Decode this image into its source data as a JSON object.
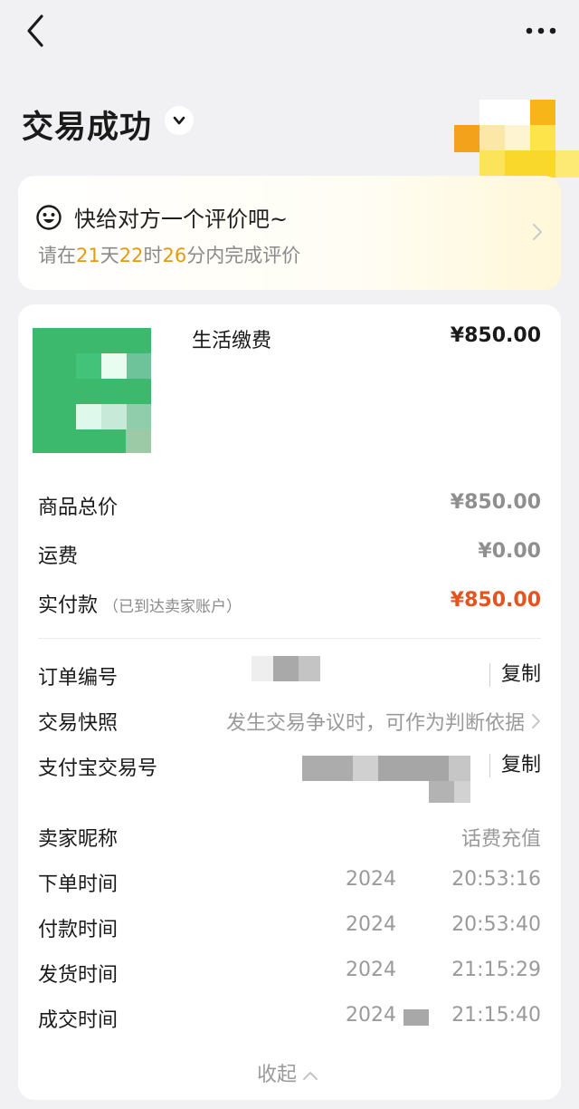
{
  "header": {
    "back_icon": "chevron-left-icon",
    "more_icon": "more-horizontal-icon"
  },
  "status": {
    "title": "交易成功"
  },
  "review": {
    "title": "快给对方一个评价吧~",
    "prefix": "请在",
    "days": "21",
    "day_unit": "天",
    "hours": "22",
    "hour_unit": "时",
    "minutes": "26",
    "suffix": "分内完成评价",
    "highlight_color": "#e79a0c"
  },
  "product": {
    "name": "生活缴费",
    "price": "¥850.00"
  },
  "prices": {
    "total_label": "商品总价",
    "total_value": "¥850.00",
    "shipping_label": "运费",
    "shipping_value": "¥0.00",
    "paid_label": "实付款",
    "paid_note": "（已到达卖家账户）",
    "paid_value": "¥850.00",
    "paid_color": "#e6531c"
  },
  "order": {
    "order_no_label": "订单编号",
    "copy_label": "复制",
    "snapshot_label": "交易快照",
    "snapshot_value": "发生交易争议时，可作为判断依据",
    "alipay_label": "支付宝交易号",
    "alipay_copy_label": "复制",
    "seller_label": "卖家昵称",
    "seller_value": "话费充值",
    "times": [
      {
        "label": "下单时间",
        "date": "2024",
        "time": "20:53:16"
      },
      {
        "label": "付款时间",
        "date": "2024",
        "time": "20:53:40"
      },
      {
        "label": "发货时间",
        "date": "2024",
        "time": "21:15:29"
      },
      {
        "label": "成交时间",
        "date": "2024",
        "time": "21:15:40"
      }
    ]
  },
  "collapse_label": "收起"
}
